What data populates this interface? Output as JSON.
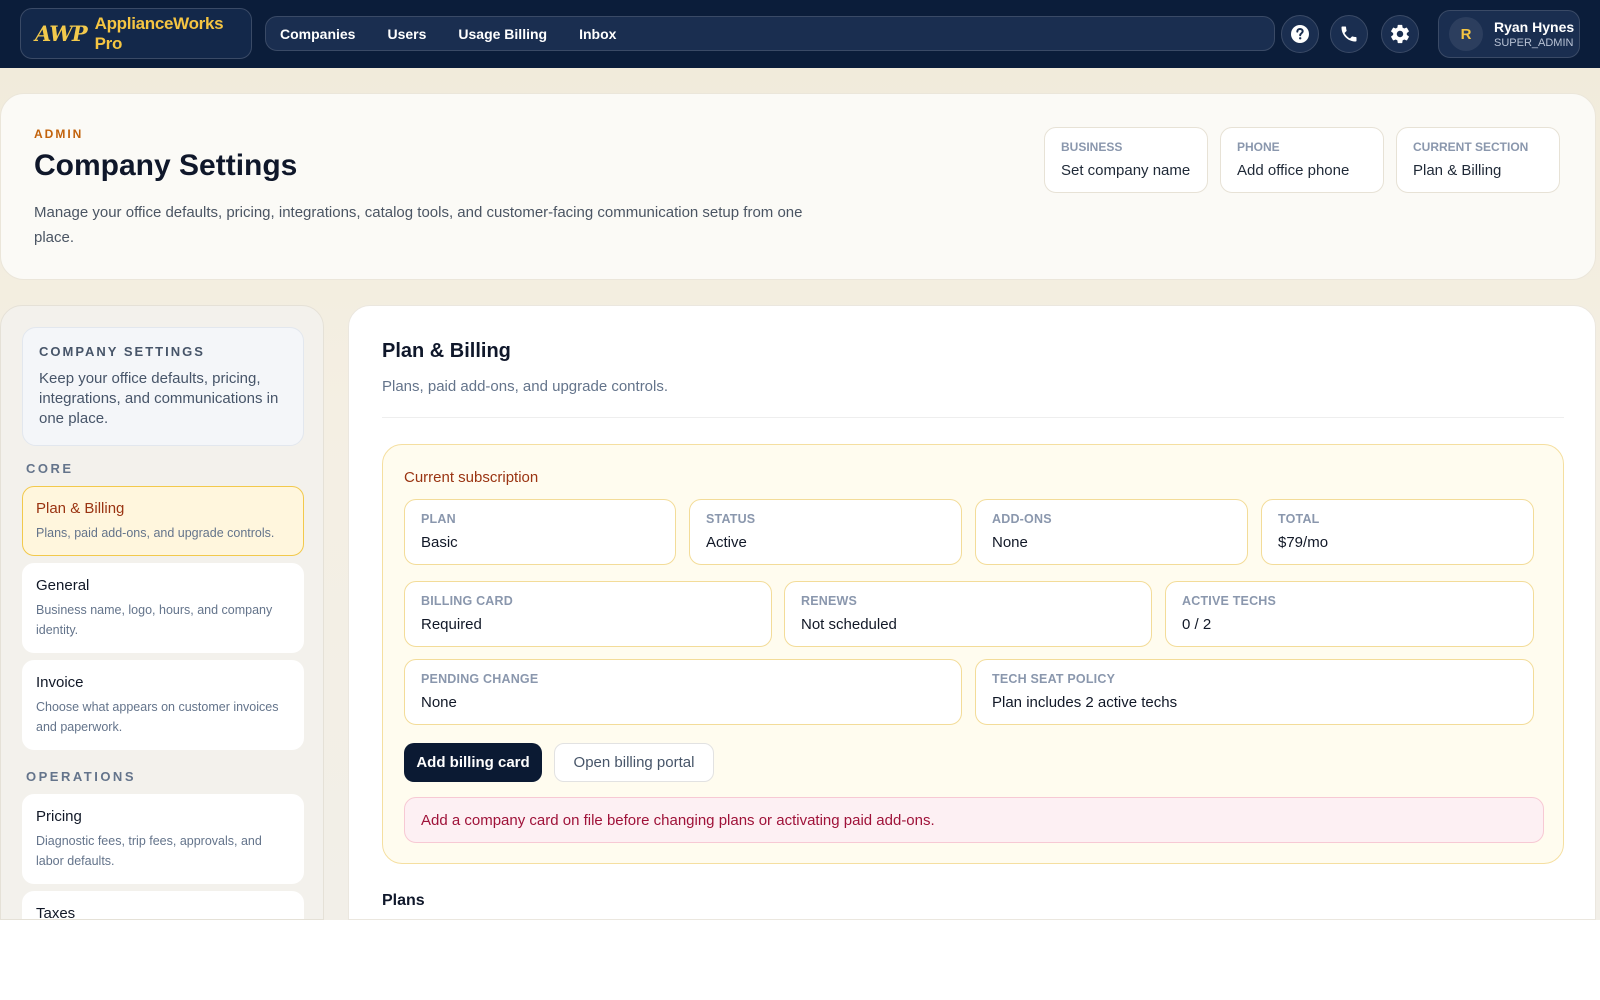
{
  "brand": {
    "mark": "AWP",
    "name": "ApplianceWorks Pro"
  },
  "nav": {
    "links": [
      "Companies",
      "Users",
      "Usage Billing",
      "Inbox"
    ]
  },
  "user": {
    "initial": "R",
    "name": "Ryan Hynes",
    "role": "SUPER_ADMIN"
  },
  "header": {
    "eyebrow": "ADMIN",
    "title": "Company Settings",
    "description": "Manage your office defaults, pricing, integrations, catalog tools, and customer-facing communication setup from one place.",
    "chips": [
      {
        "label": "BUSINESS",
        "value": "Set company name"
      },
      {
        "label": "PHONE",
        "value": "Add office phone"
      },
      {
        "label": "CURRENT SECTION",
        "value": "Plan & Billing"
      }
    ]
  },
  "sidebar": {
    "intro_title": "COMPANY SETTINGS",
    "intro_text": "Keep your office defaults, pricing, integrations, and communications in one place.",
    "groups": [
      "CORE",
      "OPERATIONS"
    ],
    "items": [
      {
        "title": "Plan & Billing",
        "desc": "Plans, paid add-ons, and upgrade controls."
      },
      {
        "title": "General",
        "desc": "Business name, logo, hours, and company identity."
      },
      {
        "title": "Invoice",
        "desc": "Choose what appears on customer invoices and paperwork."
      },
      {
        "title": "Pricing",
        "desc": "Diagnostic fees, trip fees, approvals, and labor defaults."
      },
      {
        "title": "Taxes",
        "desc": ""
      }
    ]
  },
  "main": {
    "title": "Plan & Billing",
    "description": "Plans, paid add-ons, and upgrade controls.",
    "subscription": {
      "title": "Current subscription",
      "stats": [
        {
          "label": "PLAN",
          "value": "Basic"
        },
        {
          "label": "STATUS",
          "value": "Active"
        },
        {
          "label": "ADD-ONS",
          "value": "None"
        },
        {
          "label": "TOTAL",
          "value": "$79/mo"
        },
        {
          "label": "BILLING CARD",
          "value": "Required"
        },
        {
          "label": "RENEWS",
          "value": "Not scheduled"
        },
        {
          "label": "ACTIVE TECHS",
          "value": "0 / 2"
        },
        {
          "label": "PENDING CHANGE",
          "value": "None"
        },
        {
          "label": "TECH SEAT POLICY",
          "value": "Plan includes 2 active techs"
        }
      ],
      "add_card_label": "Add billing card",
      "portal_label": "Open billing portal",
      "alert": "Add a company card on file before changing plans or activating paid add-ons."
    },
    "plans_title": "Plans"
  },
  "colors": {
    "nav_bg": "#0b1d3a",
    "brand_gold": "#f5c542",
    "accent_orange": "#c2620b",
    "alert_text": "#9f1239"
  }
}
